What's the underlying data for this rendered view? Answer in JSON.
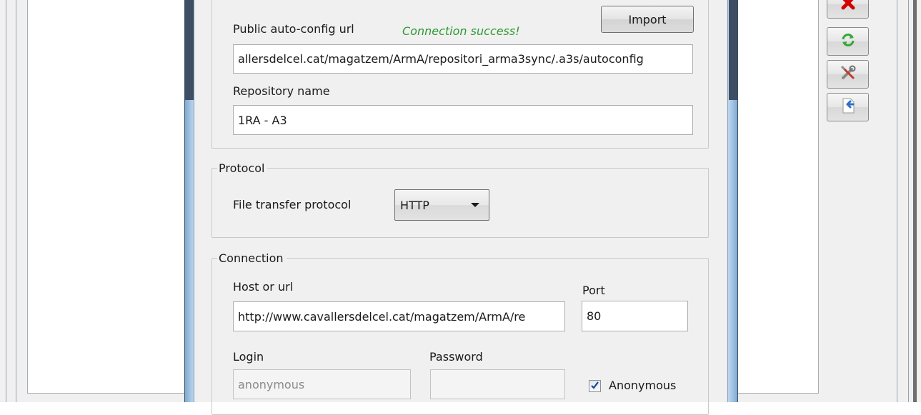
{
  "dialog": {
    "autoconfig": {
      "url_label": "Public auto-config url",
      "status": "Connection success!",
      "import_button": "Import",
      "url_value": "allersdelcel.cat/magatzem/ArmA/repositori_arma3sync/.a3s/autoconfig",
      "repo_name_label": "Repository name",
      "repo_name_value": "1RA - A3"
    },
    "protocol": {
      "legend": "Protocol",
      "label": "File transfer protocol",
      "selected": "HTTP"
    },
    "connection": {
      "legend": "Connection",
      "host_label": "Host or url",
      "host_value": "http://www.cavallersdelcel.cat/magatzem/ArmA/re",
      "port_label": "Port",
      "port_value": "80",
      "login_label": "Login",
      "login_value": "anonymous",
      "password_label": "Password",
      "password_value": "",
      "anonymous_label": "Anonymous",
      "anonymous_checked": true
    }
  },
  "toolbar": {
    "icons": [
      "delete-icon",
      "refresh-icon",
      "tools-icon",
      "export-icon"
    ],
    "delete_color": "#d40000",
    "refresh_color": "#3aa63a"
  }
}
